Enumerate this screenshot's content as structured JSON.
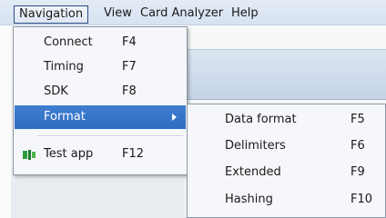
{
  "menubar": {
    "items": [
      {
        "label": "Navigation"
      },
      {
        "label": "View"
      },
      {
        "label": "Card Analyzer"
      },
      {
        "label": "Help"
      }
    ]
  },
  "navigation_menu": {
    "items": [
      {
        "label": "Connect",
        "shortcut": "F4"
      },
      {
        "label": "Timing",
        "shortcut": "F7"
      },
      {
        "label": "SDK",
        "shortcut": "F8"
      },
      {
        "label": "Format",
        "shortcut": ""
      },
      {
        "label": "Test app",
        "shortcut": "F12",
        "icon": "test-app-icon"
      }
    ],
    "highlighted": "Format",
    "highlight_color": "#3474c8"
  },
  "format_submenu": {
    "items": [
      {
        "label": "Data format",
        "shortcut": "F5"
      },
      {
        "label": "Delimiters",
        "shortcut": "F6"
      },
      {
        "label": "Extended",
        "shortcut": "F9"
      },
      {
        "label": "Hashing",
        "shortcut": "F10"
      }
    ]
  }
}
